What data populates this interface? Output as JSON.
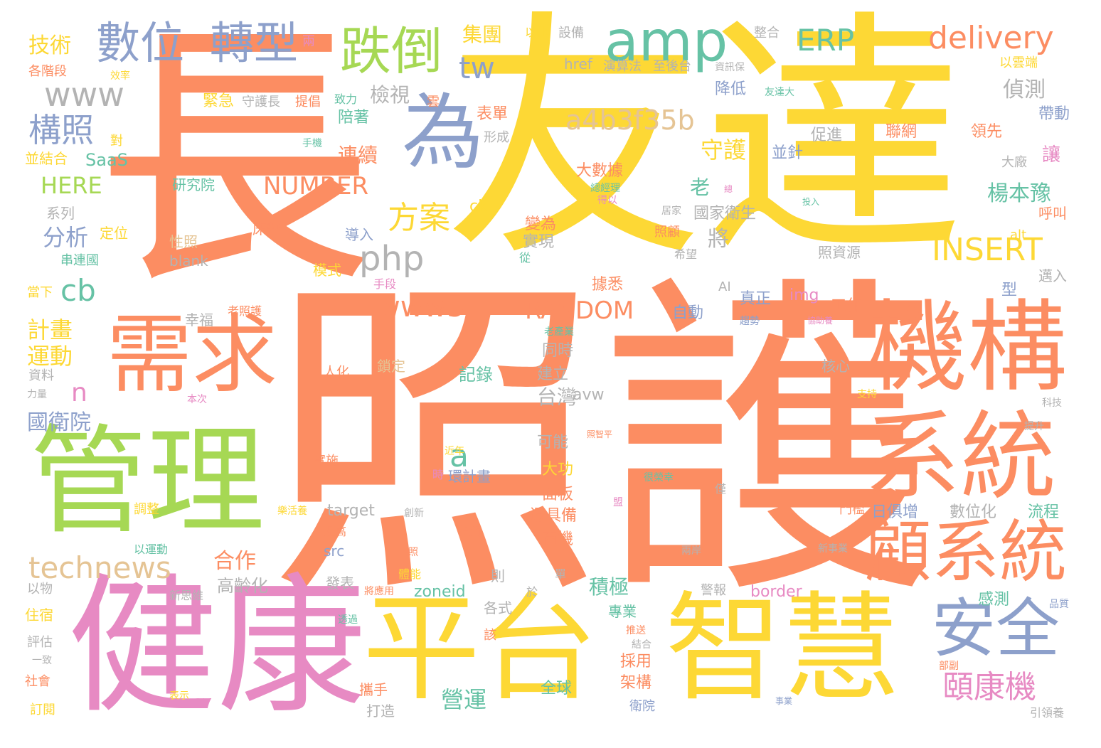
{
  "words": [
    {
      "text": "長",
      "color": "orange"
    },
    {
      "text": "友達",
      "color": "yellow"
    },
    {
      "text": "照護",
      "color": "orange"
    },
    {
      "text": "健康",
      "color": "pink"
    },
    {
      "text": "管理",
      "color": "green"
    },
    {
      "text": "平台",
      "color": "yellow"
    },
    {
      "text": "智慧",
      "color": "yellow"
    },
    {
      "text": "機構",
      "color": "orange"
    },
    {
      "text": "系統",
      "color": "orange"
    },
    {
      "text": "顧系統",
      "color": "orange"
    },
    {
      "text": "需求",
      "color": "orange"
    },
    {
      "text": "為",
      "color": "blue"
    },
    {
      "text": "安全",
      "color": "blue"
    },
    {
      "text": "amp",
      "color": "teal"
    },
    {
      "text": "跌倒",
      "color": "green"
    },
    {
      "text": "數位",
      "color": "blue"
    },
    {
      "text": "轉型",
      "color": "blue"
    },
    {
      "text": "delivery",
      "color": "orange"
    },
    {
      "text": "ERP",
      "color": "teal"
    },
    {
      "text": "a4b3f35b",
      "color": "tan"
    },
    {
      "text": "technews",
      "color": "tan"
    },
    {
      "text": "頤康機",
      "color": "pink"
    },
    {
      "text": "INSERT",
      "color": "yellow"
    },
    {
      "text": "www",
      "color": "gray"
    },
    {
      "text": "構照",
      "color": "blue"
    },
    {
      "text": "方案",
      "color": "yellow"
    },
    {
      "text": "php",
      "color": "gray"
    },
    {
      "text": "www5",
      "color": "orange"
    },
    {
      "text": "RANDOM",
      "color": "orange"
    },
    {
      "text": "NUMBER",
      "color": "orange"
    },
    {
      "text": "tw",
      "color": "blue"
    },
    {
      "text": "cb",
      "color": "teal"
    },
    {
      "text": "a",
      "color": "teal"
    },
    {
      "text": "n",
      "color": "pink"
    },
    {
      "text": "技術",
      "color": "yellow"
    },
    {
      "text": "HERE",
      "color": "green"
    },
    {
      "text": "SaaS",
      "color": "teal"
    },
    {
      "text": "分析",
      "color": "blue"
    },
    {
      "text": "計畫",
      "color": "yellow"
    },
    {
      "text": "運動",
      "color": "yellow"
    },
    {
      "text": "國衛院",
      "color": "blue"
    },
    {
      "text": "檢視",
      "color": "gray"
    },
    {
      "text": "集團",
      "color": "yellow"
    },
    {
      "text": "偵測",
      "color": "gray"
    },
    {
      "text": "守護",
      "color": "yellow"
    },
    {
      "text": "楊本豫",
      "color": "teal"
    },
    {
      "text": "連續",
      "color": "orange"
    },
    {
      "text": "台灣",
      "color": "gray"
    },
    {
      "text": "合作",
      "color": "orange"
    },
    {
      "text": "積極",
      "color": "teal"
    },
    {
      "text": "營運",
      "color": "teal"
    },
    {
      "text": "高齡化",
      "color": "gray"
    },
    {
      "text": "帶動",
      "color": "blue"
    },
    {
      "text": "讓",
      "color": "pink"
    },
    {
      "text": "老",
      "color": "teal"
    },
    {
      "text": "將",
      "color": "gray"
    },
    {
      "text": "流程",
      "color": "teal"
    },
    {
      "text": "感測",
      "color": "teal"
    },
    {
      "text": "數位化",
      "color": "gray"
    },
    {
      "text": "日俱增",
      "color": "blue"
    },
    {
      "text": "border",
      "color": "pink"
    },
    {
      "text": "zoneid",
      "color": "teal"
    },
    {
      "text": "src",
      "color": "blue"
    },
    {
      "text": "target",
      "color": "gray"
    },
    {
      "text": "img",
      "color": "pink"
    },
    {
      "text": "avw",
      "color": "gray"
    },
    {
      "text": "ck",
      "color": "yellow"
    },
    {
      "text": "alt",
      "color": "yellow"
    },
    {
      "text": "AI",
      "color": "gray"
    },
    {
      "text": "blank",
      "color": "gray"
    },
    {
      "text": "href",
      "color": "gray"
    },
    {
      "text": "全球",
      "color": "teal"
    },
    {
      "text": "架構",
      "color": "orange"
    },
    {
      "text": "採用",
      "color": "orange"
    },
    {
      "text": "商機",
      "color": "orange"
    },
    {
      "text": "還具備",
      "color": "orange"
    },
    {
      "text": "面板",
      "color": "orange"
    },
    {
      "text": "大功",
      "color": "yellow"
    },
    {
      "text": "可能",
      "color": "gray"
    },
    {
      "text": "記錄",
      "color": "teal"
    },
    {
      "text": "建立",
      "color": "gray"
    },
    {
      "text": "同時",
      "color": "gray"
    },
    {
      "text": "自動",
      "color": "blue"
    },
    {
      "text": "工作",
      "color": "orange"
    },
    {
      "text": "真正",
      "color": "blue"
    },
    {
      "text": "據悉",
      "color": "orange"
    },
    {
      "text": "實現",
      "color": "gray"
    },
    {
      "text": "變為",
      "color": "orange"
    },
    {
      "text": "國家衛生",
      "color": "gray"
    },
    {
      "text": "大數據",
      "color": "orange"
    },
    {
      "text": "並針",
      "color": "blue"
    },
    {
      "text": "聯網",
      "color": "orange"
    },
    {
      "text": "領先",
      "color": "orange"
    },
    {
      "text": "促進",
      "color": "gray"
    },
    {
      "text": "降低",
      "color": "blue"
    },
    {
      "text": "表單",
      "color": "orange"
    },
    {
      "text": "陪著",
      "color": "teal"
    },
    {
      "text": "緊急",
      "color": "yellow"
    },
    {
      "text": "研究院",
      "color": "teal"
    },
    {
      "text": "床墊",
      "color": "orange"
    },
    {
      "text": "導入",
      "color": "blue"
    },
    {
      "text": "模式",
      "color": "yellow"
    },
    {
      "text": "照資源",
      "color": "gray"
    },
    {
      "text": "呼叫",
      "color": "orange"
    },
    {
      "text": "邁入",
      "color": "gray"
    },
    {
      "text": "型",
      "color": "blue"
    },
    {
      "text": "核心",
      "color": "gray"
    },
    {
      "text": "鎖定",
      "color": "tan"
    },
    {
      "text": "幸福",
      "color": "gray"
    },
    {
      "text": "性照",
      "color": "tan"
    },
    {
      "text": "定位",
      "color": "yellow"
    },
    {
      "text": "系列",
      "color": "gray"
    },
    {
      "text": "各階段",
      "color": "orange"
    },
    {
      "text": "兩",
      "color": "pink"
    },
    {
      "text": "設備",
      "color": "gray"
    },
    {
      "text": "以此",
      "color": "yellow"
    },
    {
      "text": "整合",
      "color": "gray"
    },
    {
      "text": "以雲端",
      "color": "yellow"
    },
    {
      "text": "演算法",
      "color": "gray"
    },
    {
      "text": "至後台",
      "color": "gray"
    },
    {
      "text": "雲",
      "color": "orange"
    },
    {
      "text": "提倡",
      "color": "orange"
    },
    {
      "text": "大廠",
      "color": "gray"
    },
    {
      "text": "並結合",
      "color": "yellow"
    },
    {
      "text": "住宿",
      "color": "yellow"
    },
    {
      "text": "評估",
      "color": "gray"
    },
    {
      "text": "社會",
      "color": "orange"
    },
    {
      "text": "訂閱",
      "color": "yellow"
    },
    {
      "text": "資料",
      "color": "gray"
    },
    {
      "text": "以物",
      "color": "gray"
    },
    {
      "text": "發表",
      "color": "gray"
    },
    {
      "text": "專業",
      "color": "teal"
    },
    {
      "text": "各式",
      "color": "gray"
    },
    {
      "text": "警報",
      "color": "gray"
    },
    {
      "text": "門檻",
      "color": "orange"
    },
    {
      "text": "衛院",
      "color": "blue"
    },
    {
      "text": "攜手",
      "color": "orange"
    },
    {
      "text": "打造",
      "color": "gray"
    },
    {
      "text": "該",
      "color": "orange"
    },
    {
      "text": "投資",
      "color": "orange"
    },
    {
      "text": "實施",
      "color": "orange"
    },
    {
      "text": "人化",
      "color": "orange"
    },
    {
      "text": "調整",
      "color": "yellow"
    },
    {
      "text": "提高",
      "color": "orange"
    },
    {
      "text": "日照",
      "color": "orange"
    },
    {
      "text": "照顧",
      "color": "orange"
    },
    {
      "text": "從",
      "color": "teal"
    },
    {
      "text": "希望",
      "color": "gray"
    },
    {
      "text": "居家",
      "color": "gray"
    },
    {
      "text": "老照護",
      "color": "orange"
    },
    {
      "text": "手段",
      "color": "pink"
    },
    {
      "text": "守護長",
      "color": "gray"
    },
    {
      "text": "效率",
      "color": "yellow"
    },
    {
      "text": "形成",
      "color": "gray"
    },
    {
      "text": "手機",
      "color": "teal"
    },
    {
      "text": "對",
      "color": "yellow"
    },
    {
      "text": "力量",
      "color": "gray"
    },
    {
      "text": "本次",
      "color": "pink"
    },
    {
      "text": "當下",
      "color": "yellow"
    },
    {
      "text": "串連國",
      "color": "teal"
    },
    {
      "text": "一致",
      "color": "gray"
    },
    {
      "text": "表示",
      "color": "yellow"
    },
    {
      "text": "透過",
      "color": "teal"
    },
    {
      "text": "將應用",
      "color": "orange"
    },
    {
      "text": "體能",
      "color": "yellow"
    },
    {
      "text": "推送",
      "color": "orange"
    },
    {
      "text": "結合",
      "color": "gray"
    },
    {
      "text": "新思維",
      "color": "gray"
    },
    {
      "text": "則",
      "color": "gray"
    },
    {
      "text": "環計畫",
      "color": "blue"
    },
    {
      "text": "時",
      "color": "pink"
    },
    {
      "text": "很榮幸",
      "color": "teal"
    },
    {
      "text": "支持",
      "color": "yellow"
    },
    {
      "text": "新事業",
      "color": "gray"
    },
    {
      "text": "兩岸",
      "color": "gray"
    },
    {
      "text": "科技",
      "color": "gray"
    },
    {
      "text": "提升",
      "color": "gray"
    },
    {
      "text": "品質",
      "color": "blue"
    },
    {
      "text": "事業",
      "color": "blue"
    },
    {
      "text": "部副",
      "color": "orange"
    },
    {
      "text": "引領養",
      "color": "gray"
    },
    {
      "text": "總經理",
      "color": "teal"
    },
    {
      "text": "得以",
      "color": "pink"
    },
    {
      "text": "投入",
      "color": "teal"
    },
    {
      "text": "趨勢",
      "color": "blue"
    },
    {
      "text": "協助養",
      "color": "pink"
    },
    {
      "text": "老產業",
      "color": "teal"
    },
    {
      "text": "資訊保",
      "color": "gray"
    },
    {
      "text": "友達大",
      "color": "teal"
    },
    {
      "text": "致力",
      "color": "teal"
    },
    {
      "text": "創新",
      "color": "gray"
    },
    {
      "text": "以運動",
      "color": "teal"
    },
    {
      "text": "樂活養",
      "color": "yellow"
    },
    {
      "text": "近年",
      "color": "yellow"
    },
    {
      "text": "照智平",
      "color": "orange"
    },
    {
      "text": "於",
      "color": "gray"
    },
    {
      "text": "單",
      "color": "gray"
    },
    {
      "text": "盟",
      "color": "pink"
    },
    {
      "text": "總",
      "color": "pink"
    },
    {
      "text": "僅",
      "color": "gray"
    }
  ]
}
